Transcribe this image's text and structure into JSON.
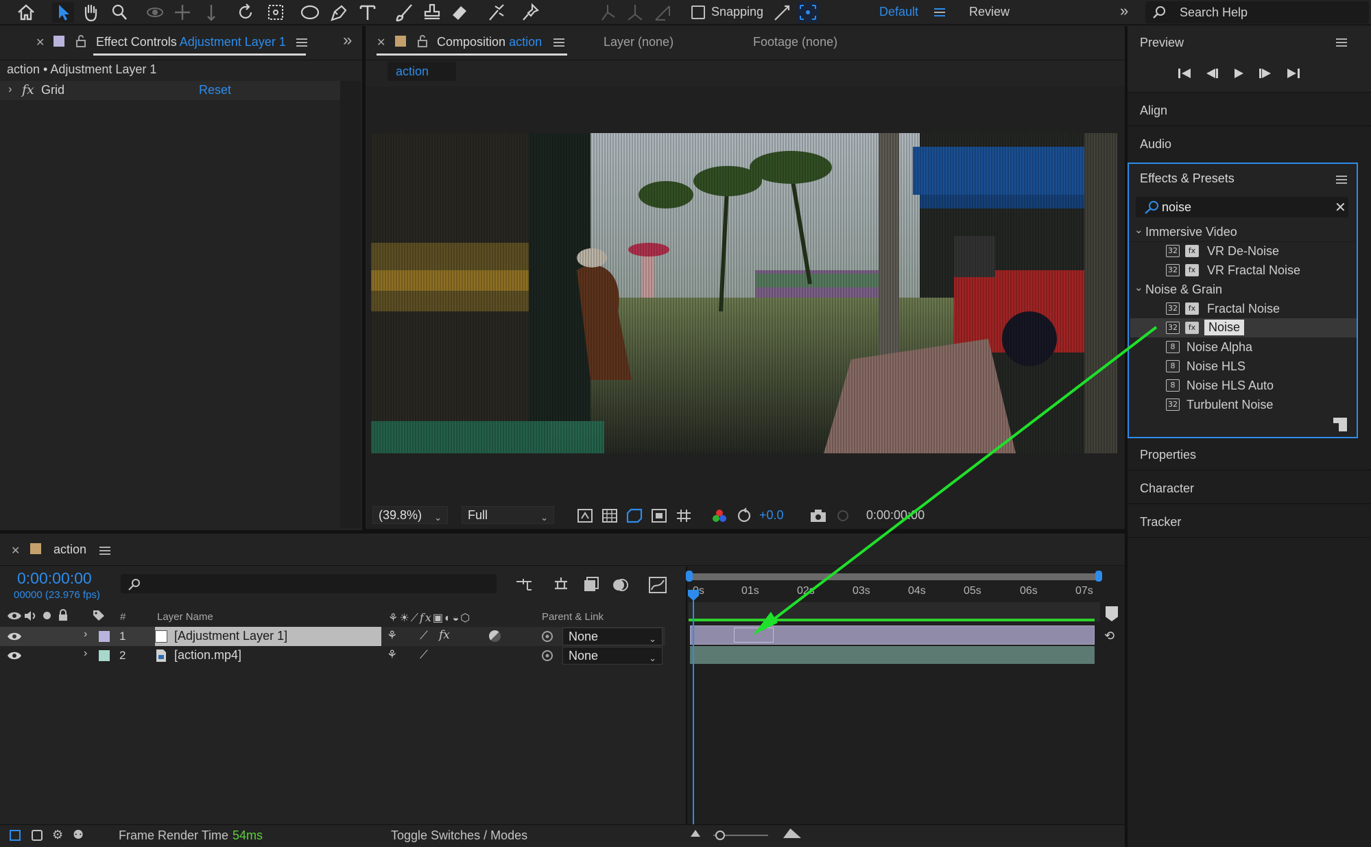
{
  "toolbar": {
    "snapping_label": "Snapping",
    "workspace_active": "Default",
    "workspace_other": "Review",
    "search_help_placeholder": "Search Help"
  },
  "effect_controls": {
    "tab_title": "Effect Controls",
    "tab_layer": "Adjustment Layer 1",
    "breadcrumb": "action • Adjustment Layer 1",
    "effect_name": "Grid",
    "reset_label": "Reset"
  },
  "composition": {
    "tab_title": "Composition",
    "tab_comp": "action",
    "layer_tab": "Layer (none)",
    "footage_tab": "Footage (none)",
    "sub_tab": "action",
    "zoom": "(39.8%)",
    "resolution": "Full",
    "exposure": "+0.0",
    "timecode": "0:00:00:00"
  },
  "preview": {
    "title": "Preview"
  },
  "panels": {
    "align": "Align",
    "audio": "Audio",
    "properties": "Properties",
    "character": "Character",
    "tracker": "Tracker"
  },
  "effects_presets": {
    "title": "Effects & Presets",
    "search_value": "noise",
    "groups": [
      {
        "name": "Immersive Video",
        "items": [
          {
            "label": "VR De-Noise",
            "badge": "32"
          },
          {
            "label": "VR Fractal Noise",
            "badge": "32"
          }
        ]
      },
      {
        "name": "Noise & Grain",
        "items": [
          {
            "label": "Fractal Noise",
            "badge": "32"
          },
          {
            "label": "Noise",
            "badge": "32"
          },
          {
            "label": "Noise Alpha",
            "badge": "8"
          },
          {
            "label": "Noise HLS",
            "badge": "8"
          },
          {
            "label": "Noise HLS Auto",
            "badge": "8"
          },
          {
            "label": "Turbulent Noise",
            "badge": "32"
          }
        ]
      }
    ]
  },
  "timeline": {
    "tab_title": "action",
    "timecode": "0:00:00:00",
    "fps": "00000 (23.976 fps)",
    "columns": {
      "num": "#",
      "layer_name": "Layer Name",
      "parent": "Parent & Link"
    },
    "ruler": [
      "0s",
      "01s",
      "02s",
      "03s",
      "04s",
      "05s",
      "06s",
      "07s"
    ],
    "layers": [
      {
        "num": "1",
        "name": "[Adjustment Layer 1]",
        "parent": "None",
        "label_color": "#b8b4dc"
      },
      {
        "num": "2",
        "name": "[action.mp4]",
        "parent": "None",
        "label_color": "#a8d8cc"
      }
    ],
    "footer": {
      "frame_render_label": "Frame Render Time",
      "frame_render_value": "54ms",
      "toggle_label": "Toggle Switches / Modes"
    }
  },
  "colors": {
    "accent_blue": "#2d8ceb",
    "annotation_green": "#1fe02a",
    "render_time_green": "#5fcf3c"
  }
}
